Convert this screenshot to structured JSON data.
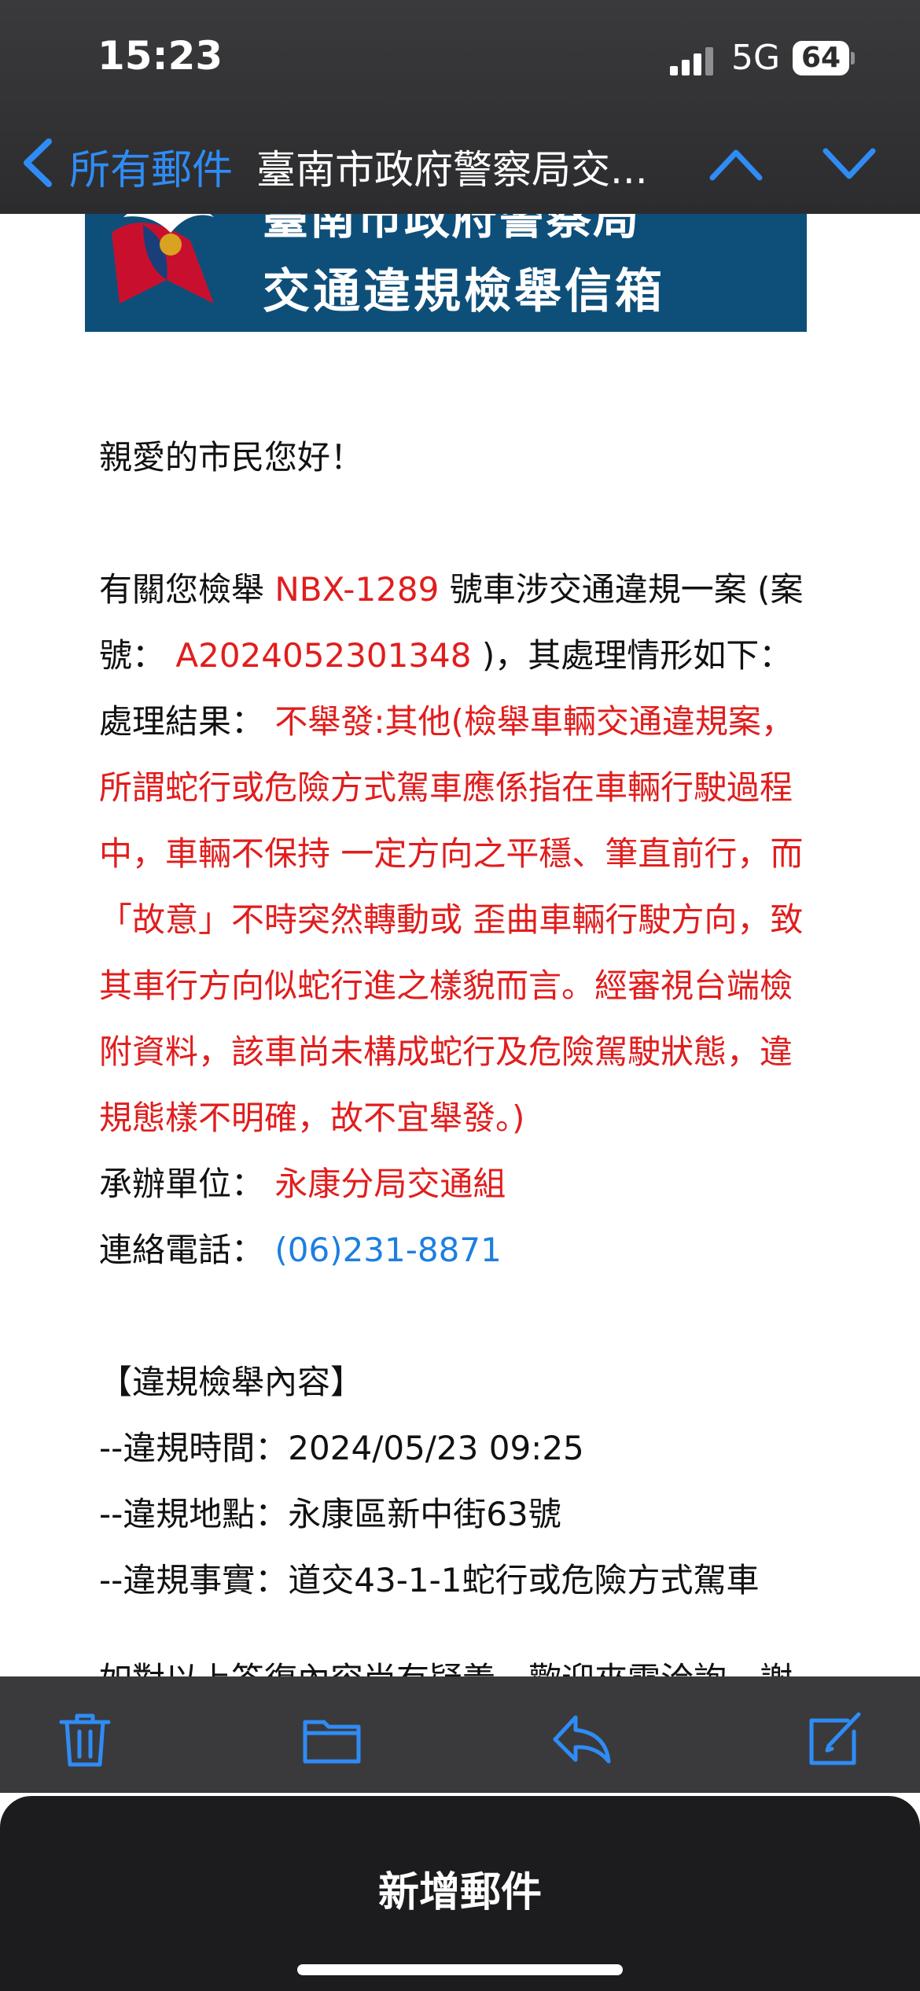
{
  "status": {
    "time": "15:23",
    "network": "5G",
    "battery": "64"
  },
  "nav": {
    "back_label": "所有郵件",
    "title": "臺南市政府警察局交...",
    "icons": {
      "back": "chevron-left-icon",
      "up": "chevron-up-icon",
      "down": "chevron-down-icon"
    }
  },
  "banner": {
    "line1": "臺南市政府警察局",
    "line2": "交通違規檢舉信箱"
  },
  "email": {
    "greeting": "親愛的市民您好！",
    "p1_a": "有關您檢舉",
    "plate": "NBX-1289",
    "p1_b": "號車涉交通違規一案 (案",
    "p2_a": "號：",
    "case_no": "A2024052301348",
    "p2_b": ")，其處理情形如下：",
    "result_label": "處理結果：",
    "result_lines": [
      "不舉發:其他(檢舉車輛交通違規案，",
      "所謂蛇行或危險方式駕車應係指在車輛行駛過程",
      "中，車輛不保持 一定方向之平穩、筆直前行，而",
      "「故意」不時突然轉動或 歪曲車輛行駛方向，致",
      "其車行方向似蛇行進之樣貌而言。經審視台端檢",
      "附資料，該車尚未構成蛇行及危險駕駛狀態，違",
      "規態樣不明確，故不宜舉發。)"
    ],
    "unit_label": "承辦單位：",
    "unit": "永康分局交通組",
    "phone_label": "連絡電話：",
    "phone": "(06)231-8871",
    "section_title": "【違規檢舉內容】",
    "detail_lines": [
      "--違規時間：2024/05/23 09:25",
      "--違規地點：永康區新中街63號",
      "--違規事實：道交43-1-1蛇行或危險方式駕車"
    ],
    "closing": "如對以上答復內容尚有疑義，歡迎來電洽詢，謝"
  },
  "toolbar": {
    "icons": [
      "trash-icon",
      "folder-icon",
      "reply-icon",
      "compose-icon"
    ]
  },
  "compose": {
    "label": "新增郵件"
  },
  "colors": {
    "accent": "#2f8cf5",
    "red": "#e11d1d",
    "link": "#1c7fe0",
    "banner": "#0e4f7a"
  }
}
